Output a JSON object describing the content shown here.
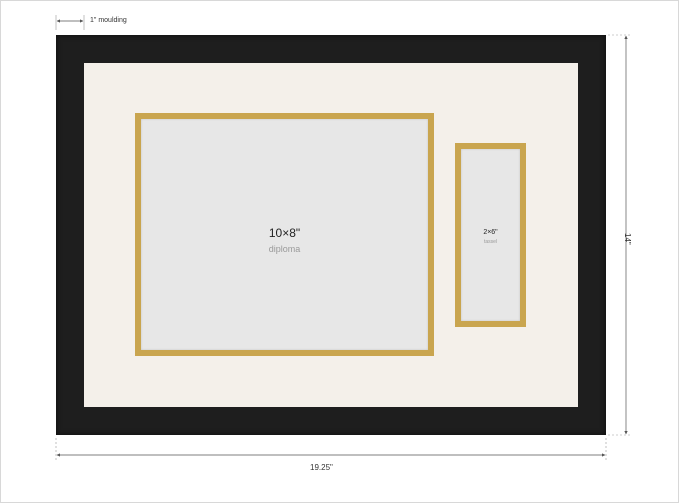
{
  "frame": {
    "moulding_label": "1\" moulding",
    "width_label": "19.25\"",
    "height_label": "14\"",
    "moulding_color": "#1e1e1e",
    "mat_color": "#f4f0ea"
  },
  "openings": [
    {
      "size": "10×8\"",
      "label": "diploma",
      "border_color": "#c9a54f"
    },
    {
      "size": "2×6\"",
      "label": "tassel",
      "border_color": "#c9a54f"
    }
  ]
}
